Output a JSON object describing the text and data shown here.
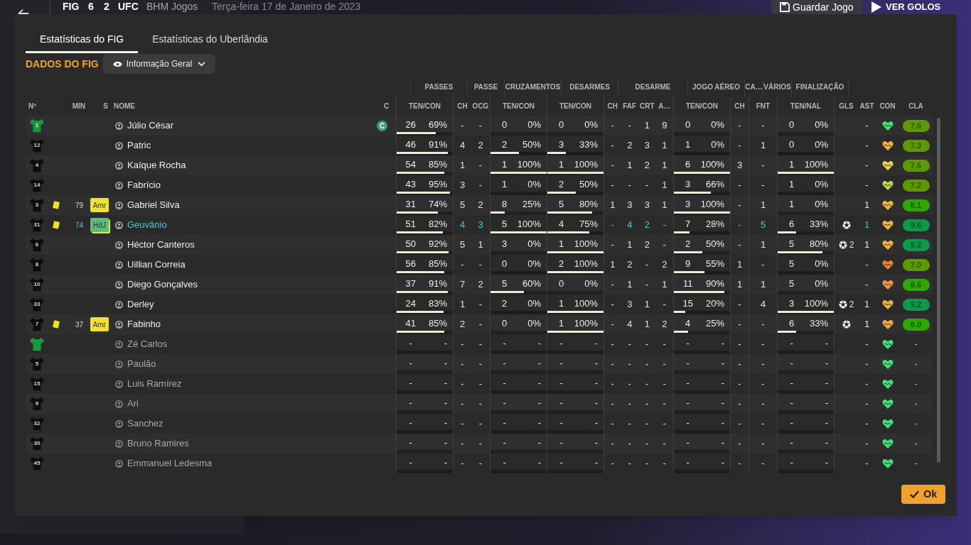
{
  "topbar": {
    "home": "FIG",
    "score_home": "6",
    "score_away": "2",
    "away": "UFC",
    "competition": "BHM Jogos",
    "date": "Terça-feira 17 de Janeiro de 2023",
    "save_button": "Guardar Jogo",
    "goals_button": "VER GOLOS"
  },
  "tabs": [
    {
      "label": "Estatísticas do FIG",
      "selected": true
    },
    {
      "label": "Estatísticas do Uberlândia",
      "selected": false
    }
  ],
  "section_title": "DADOS DO FIG",
  "view_dropdown": "Informação Geral",
  "header_groups": [
    "PASSES",
    "PASSE",
    "CRUZAMENTOS",
    "DESARMES",
    "DESARME",
    "JOGO AÉREO",
    "CA…",
    "VÁRIOS",
    "FINALIZAÇÃO"
  ],
  "columns": [
    "Nº",
    "MIN",
    "S",
    "NOME",
    "C",
    "TEN/CON",
    "CH",
    "OCG",
    "TEN/CON",
    "TEN/CON",
    "CH",
    "FAF",
    "CRT",
    "A…",
    "TEN/CON",
    "CH",
    "FNT",
    "TEN/NAL",
    "GLS",
    "AST",
    "CON",
    "CLA"
  ],
  "rows": [
    {
      "number": "1",
      "goalkeeper": true,
      "highlighted": false,
      "played": true,
      "name": "Júlio César",
      "captain": "C",
      "passes": {
        "ten": "26",
        "con": "69%",
        "level": 0.69
      },
      "passe": [
        "-",
        "-"
      ],
      "cruzamentos": {
        "ten": "0",
        "con": "0%"
      },
      "desarmes": {
        "ten": "0",
        "con": "0%"
      },
      "desarme": [
        "-",
        "-",
        "1",
        "9"
      ],
      "jogo_aereo": {
        "ten": "0",
        "con": "0%"
      },
      "ca": "-",
      "varios": "-",
      "finalizacao": {
        "ten": "0",
        "con": "0%"
      },
      "assists": "-",
      "condition": {
        "color": "#3ee07a"
      },
      "rating": {
        "text": "7.6",
        "color": "#5c9a00"
      }
    },
    {
      "number": "12",
      "goalkeeper": false,
      "highlighted": false,
      "played": true,
      "name": "Patric",
      "passes": {
        "ten": "46",
        "con": "91%",
        "level": 0.91
      },
      "passe": [
        "4",
        "2"
      ],
      "cruzamentos": {
        "ten": "2",
        "con": "50%",
        "level": 0.5
      },
      "desarmes": {
        "ten": "3",
        "con": "33%",
        "level": 0.33
      },
      "desarme": [
        "-",
        "2",
        "3",
        "1"
      ],
      "jogo_aereo": {
        "ten": "1",
        "con": "0%"
      },
      "ca": "-",
      "varios": "1",
      "finalizacao": {
        "ten": "0",
        "con": "0%"
      },
      "assists": "-",
      "condition": {
        "color": "#f4b23a"
      },
      "rating": {
        "text": "7.3",
        "color": "#5c9a00"
      }
    },
    {
      "number": "4",
      "goalkeeper": false,
      "highlighted": false,
      "played": true,
      "name": "Kaíque Rocha",
      "passes": {
        "ten": "54",
        "con": "85%",
        "level": 0.85
      },
      "passe": [
        "1",
        "-"
      ],
      "cruzamentos": {
        "ten": "1",
        "con": "100%",
        "level": 1
      },
      "desarmes": {
        "ten": "1",
        "con": "100%",
        "level": 1
      },
      "desarme": [
        "-",
        "1",
        "2",
        "1"
      ],
      "jogo_aereo": {
        "ten": "6",
        "con": "100%",
        "level": 1
      },
      "ca": "3",
      "varios": "-",
      "finalizacao": {
        "ten": "1",
        "con": "100%",
        "level": 1
      },
      "assists": "-",
      "condition": {
        "color": "#f2cf45"
      },
      "rating": {
        "text": "7.6",
        "color": "#5c9a00"
      }
    },
    {
      "number": "14",
      "goalkeeper": false,
      "highlighted": false,
      "played": true,
      "name": "Fabrício",
      "passes": {
        "ten": "43",
        "con": "95%",
        "level": 0.95
      },
      "passe": [
        "3",
        "-"
      ],
      "cruzamentos": {
        "ten": "1",
        "con": "0%"
      },
      "desarmes": {
        "ten": "2",
        "con": "50%",
        "level": 0.5
      },
      "desarme": [
        "-",
        "-",
        "-",
        "1"
      ],
      "jogo_aereo": {
        "ten": "3",
        "con": "66%",
        "level": 0.66
      },
      "ca": "-",
      "varios": "-",
      "finalizacao": {
        "ten": "1",
        "con": "0%"
      },
      "assists": "-",
      "condition": {
        "color": "#b9d84a"
      },
      "rating": {
        "text": "7.2",
        "color": "#5c9a00"
      }
    },
    {
      "number": "3",
      "goalkeeper": false,
      "yellow_card": true,
      "minute": "79",
      "sub": {
        "label": "Amr",
        "kind": "booked"
      },
      "highlighted": false,
      "played": true,
      "name": "Gabriel Silva",
      "passes": {
        "ten": "31",
        "con": "74%",
        "level": 0.74
      },
      "passe": [
        "5",
        "2"
      ],
      "cruzamentos": {
        "ten": "8",
        "con": "25%",
        "level": 0.25
      },
      "desarmes": {
        "ten": "5",
        "con": "80%",
        "level": 0.8
      },
      "desarme": [
        "1",
        "3",
        "3",
        "1"
      ],
      "jogo_aereo": {
        "ten": "3",
        "con": "100%",
        "level": 1
      },
      "ca": "-",
      "varios": "1",
      "finalizacao": {
        "ten": "1",
        "con": "0%"
      },
      "assists": "1",
      "condition": {
        "color": "#f4b23a"
      },
      "rating": {
        "text": "8.1",
        "color": "#2ea800"
      }
    },
    {
      "number": "31",
      "goalkeeper": false,
      "yellow_card": true,
      "minute": "74",
      "sub": {
        "label": "HdJ",
        "kind": "award"
      },
      "highlighted": true,
      "played": true,
      "name": "Geuvânio",
      "passes": {
        "ten": "51",
        "con": "82%",
        "level": 0.82
      },
      "passe": [
        "4",
        "3"
      ],
      "cruzamentos": {
        "ten": "5",
        "con": "100%",
        "level": 1
      },
      "desarmes": {
        "ten": "4",
        "con": "75%",
        "level": 0.75
      },
      "desarme": [
        "-",
        "4",
        "2",
        "-"
      ],
      "jogo_aereo": {
        "ten": "7",
        "con": "28%",
        "level": 0.28
      },
      "ca": "-",
      "varios": "5",
      "finalizacao": {
        "ten": "6",
        "con": "33%",
        "level": 0.33
      },
      "scored": true,
      "assists": "1",
      "condition": {
        "color": "#f4b23a"
      },
      "rating": {
        "text": "9.6",
        "color": "#0c9a48"
      }
    },
    {
      "number": "6",
      "goalkeeper": false,
      "highlighted": false,
      "played": true,
      "name": "Héctor Canteros",
      "passes": {
        "ten": "50",
        "con": "92%",
        "level": 0.92
      },
      "passe": [
        "5",
        "1"
      ],
      "cruzamentos": {
        "ten": "3",
        "con": "0%"
      },
      "desarmes": {
        "ten": "1",
        "con": "100%",
        "level": 1
      },
      "desarme": [
        "-",
        "1",
        "2",
        "-"
      ],
      "jogo_aereo": {
        "ten": "2",
        "con": "50%",
        "level": 0.5
      },
      "ca": "-",
      "varios": "1",
      "finalizacao": {
        "ten": "5",
        "con": "80%",
        "level": 0.8
      },
      "scored": true,
      "goals": "2",
      "assists": "1",
      "condition": {
        "color": "#f4b23a"
      },
      "rating": {
        "text": "9.2",
        "color": "#0c9a48"
      }
    },
    {
      "number": "8",
      "goalkeeper": false,
      "highlighted": false,
      "played": true,
      "name": "Uillian Correia",
      "passes": {
        "ten": "56",
        "con": "85%",
        "level": 0.85
      },
      "passe": [
        "-",
        "-"
      ],
      "cruzamentos": {
        "ten": "0",
        "con": "0%"
      },
      "desarmes": {
        "ten": "2",
        "con": "100%",
        "level": 1
      },
      "desarme": [
        "1",
        "2",
        "-",
        "2"
      ],
      "jogo_aereo": {
        "ten": "9",
        "con": "55%",
        "level": 0.55
      },
      "ca": "1",
      "varios": "-",
      "finalizacao": {
        "ten": "5",
        "con": "0%"
      },
      "assists": "-",
      "condition": {
        "color": "#f07a30"
      },
      "rating": {
        "text": "7.0",
        "color": "#5c9a00"
      }
    },
    {
      "number": "10",
      "goalkeeper": false,
      "highlighted": false,
      "played": true,
      "name": "Diego Gonçalves",
      "passes": {
        "ten": "37",
        "con": "91%",
        "level": 0.91
      },
      "passe": [
        "7",
        "2"
      ],
      "cruzamentos": {
        "ten": "5",
        "con": "60%",
        "level": 0.6
      },
      "desarmes": {
        "ten": "0",
        "con": "0%"
      },
      "desarme": [
        "-",
        "1",
        "-",
        "1"
      ],
      "jogo_aereo": {
        "ten": "11",
        "con": "90%",
        "level": 0.9
      },
      "ca": "1",
      "varios": "1",
      "finalizacao": {
        "ten": "5",
        "con": "0%"
      },
      "assists": "-",
      "condition": {
        "color": "#f29a3c"
      },
      "rating": {
        "text": "8.6",
        "color": "#2ea800"
      }
    },
    {
      "number": "33",
      "goalkeeper": false,
      "highlighted": false,
      "played": true,
      "name": "Derley",
      "passes": {
        "ten": "24",
        "con": "83%",
        "level": 0.83
      },
      "passe": [
        "1",
        "-"
      ],
      "cruzamentos": {
        "ten": "2",
        "con": "0%"
      },
      "desarmes": {
        "ten": "1",
        "con": "100%",
        "level": 1
      },
      "desarme": [
        "-",
        "3",
        "1",
        "-"
      ],
      "jogo_aereo": {
        "ten": "15",
        "con": "20%",
        "level": 0.2
      },
      "ca": "-",
      "varios": "4",
      "finalizacao": {
        "ten": "3",
        "con": "100%",
        "level": 1
      },
      "scored": true,
      "goals": "2",
      "assists": "1",
      "condition": {
        "color": "#f4b23a"
      },
      "rating": {
        "text": "9.2",
        "color": "#0c9a48"
      }
    },
    {
      "number": "7",
      "goalkeeper": false,
      "yellow_card": true,
      "minute": "37",
      "sub": {
        "label": "Amr",
        "kind": "booked"
      },
      "highlighted": false,
      "played": true,
      "name": "Fabinho",
      "passes": {
        "ten": "41",
        "con": "85%",
        "level": 0.85
      },
      "passe": [
        "2",
        "-"
      ],
      "cruzamentos": {
        "ten": "0",
        "con": "0%"
      },
      "desarmes": {
        "ten": "1",
        "con": "100%",
        "level": 1
      },
      "desarme": [
        "-",
        "4",
        "1",
        "2"
      ],
      "jogo_aereo": {
        "ten": "4",
        "con": "25%",
        "level": 0.25
      },
      "ca": "-",
      "varios": "-",
      "finalizacao": {
        "ten": "6",
        "con": "33%",
        "level": 0.33
      },
      "scored": true,
      "assists": "1",
      "condition": {
        "color": "#f4a83a"
      },
      "rating": {
        "text": "8.0",
        "color": "#2ea800"
      }
    },
    {
      "goalkeeper": true,
      "highlighted": false,
      "played": false,
      "name": "Zé Carlos",
      "passes": {
        "ten": "-",
        "con": "-"
      },
      "passe": [
        "-",
        "-"
      ],
      "cruzamentos": {
        "ten": "-",
        "con": "-"
      },
      "desarmes": {
        "ten": "-",
        "con": "-"
      },
      "desarme": [
        "-",
        "-",
        "-",
        "-"
      ],
      "jogo_aereo": {
        "ten": "-",
        "con": "-"
      },
      "ca": "-",
      "varios": "-",
      "finalizacao": {
        "ten": "-",
        "con": "-"
      },
      "assists": "-",
      "condition": {
        "color": "#3ee07a"
      },
      "rating": {
        "text": "-"
      }
    },
    {
      "number": "5",
      "goalkeeper": false,
      "highlighted": false,
      "played": false,
      "name": "Paulão",
      "passes": {
        "ten": "-",
        "con": "-"
      },
      "passe": [
        "-",
        "-"
      ],
      "cruzamentos": {
        "ten": "-",
        "con": "-"
      },
      "desarmes": {
        "ten": "-",
        "con": "-"
      },
      "desarme": [
        "-",
        "-",
        "-",
        "-"
      ],
      "jogo_aereo": {
        "ten": "-",
        "con": "-"
      },
      "ca": "-",
      "varios": "-",
      "finalizacao": {
        "ten": "-",
        "con": "-"
      },
      "assists": "-",
      "condition": {
        "color": "#3ee07a"
      },
      "rating": {
        "text": "-"
      }
    },
    {
      "number": "15",
      "goalkeeper": false,
      "highlighted": false,
      "played": false,
      "name": "Luis Ramírez",
      "passes": {
        "ten": "-",
        "con": "-"
      },
      "passe": [
        "-",
        "-"
      ],
      "cruzamentos": {
        "ten": "-",
        "con": "-"
      },
      "desarmes": {
        "ten": "-",
        "con": "-"
      },
      "desarme": [
        "-",
        "-",
        "-",
        "-"
      ],
      "jogo_aereo": {
        "ten": "-",
        "con": "-"
      },
      "ca": "-",
      "varios": "-",
      "finalizacao": {
        "ten": "-",
        "con": "-"
      },
      "assists": "-",
      "condition": {
        "color": "#3ee07a"
      },
      "rating": {
        "text": "-"
      }
    },
    {
      "number": "9",
      "goalkeeper": false,
      "highlighted": false,
      "played": false,
      "name": "Ari",
      "passes": {
        "ten": "-",
        "con": "-"
      },
      "passe": [
        "-",
        "-"
      ],
      "cruzamentos": {
        "ten": "-",
        "con": "-"
      },
      "desarmes": {
        "ten": "-",
        "con": "-"
      },
      "desarme": [
        "-",
        "-",
        "-",
        "-"
      ],
      "jogo_aereo": {
        "ten": "-",
        "con": "-"
      },
      "ca": "-",
      "varios": "-",
      "finalizacao": {
        "ten": "-",
        "con": "-"
      },
      "assists": "-",
      "condition": {
        "color": "#3ee07a"
      },
      "rating": {
        "text": "-"
      }
    },
    {
      "number": "32",
      "goalkeeper": false,
      "highlighted": false,
      "played": false,
      "name": "Sanchez",
      "passes": {
        "ten": "-",
        "con": "-"
      },
      "passe": [
        "-",
        "-"
      ],
      "cruzamentos": {
        "ten": "-",
        "con": "-"
      },
      "desarmes": {
        "ten": "-",
        "con": "-"
      },
      "desarme": [
        "-",
        "-",
        "-",
        "-"
      ],
      "jogo_aereo": {
        "ten": "-",
        "con": "-"
      },
      "ca": "-",
      "varios": "-",
      "finalizacao": {
        "ten": "-",
        "con": "-"
      },
      "assists": "-",
      "condition": {
        "color": "#3ee07a"
      },
      "rating": {
        "text": "-"
      }
    },
    {
      "number": "30",
      "goalkeeper": false,
      "highlighted": false,
      "played": false,
      "name": "Bruno Ramires",
      "passes": {
        "ten": "-",
        "con": "-"
      },
      "passe": [
        "-",
        "-"
      ],
      "cruzamentos": {
        "ten": "-",
        "con": "-"
      },
      "desarmes": {
        "ten": "-",
        "con": "-"
      },
      "desarme": [
        "-",
        "-",
        "-",
        "-"
      ],
      "jogo_aereo": {
        "ten": "-",
        "con": "-"
      },
      "ca": "-",
      "varios": "-",
      "finalizacao": {
        "ten": "-",
        "con": "-"
      },
      "assists": "-",
      "condition": {
        "color": "#3ee07a"
      },
      "rating": {
        "text": "-"
      }
    },
    {
      "number": "45",
      "goalkeeper": false,
      "highlighted": false,
      "played": false,
      "name": "Emmanuel Ledesma",
      "passes": {
        "ten": "-",
        "con": "-"
      },
      "passe": [
        "-",
        "-"
      ],
      "cruzamentos": {
        "ten": "-",
        "con": "-"
      },
      "desarmes": {
        "ten": "-",
        "con": "-"
      },
      "desarme": [
        "-",
        "-",
        "-",
        "-"
      ],
      "jogo_aereo": {
        "ten": "-",
        "con": "-"
      },
      "ca": "-",
      "varios": "-",
      "finalizacao": {
        "ten": "-",
        "con": "-"
      },
      "assists": "-",
      "condition": {
        "color": "#3ee07a"
      },
      "rating": {
        "text": "-"
      }
    }
  ],
  "ok_button": "Ok"
}
